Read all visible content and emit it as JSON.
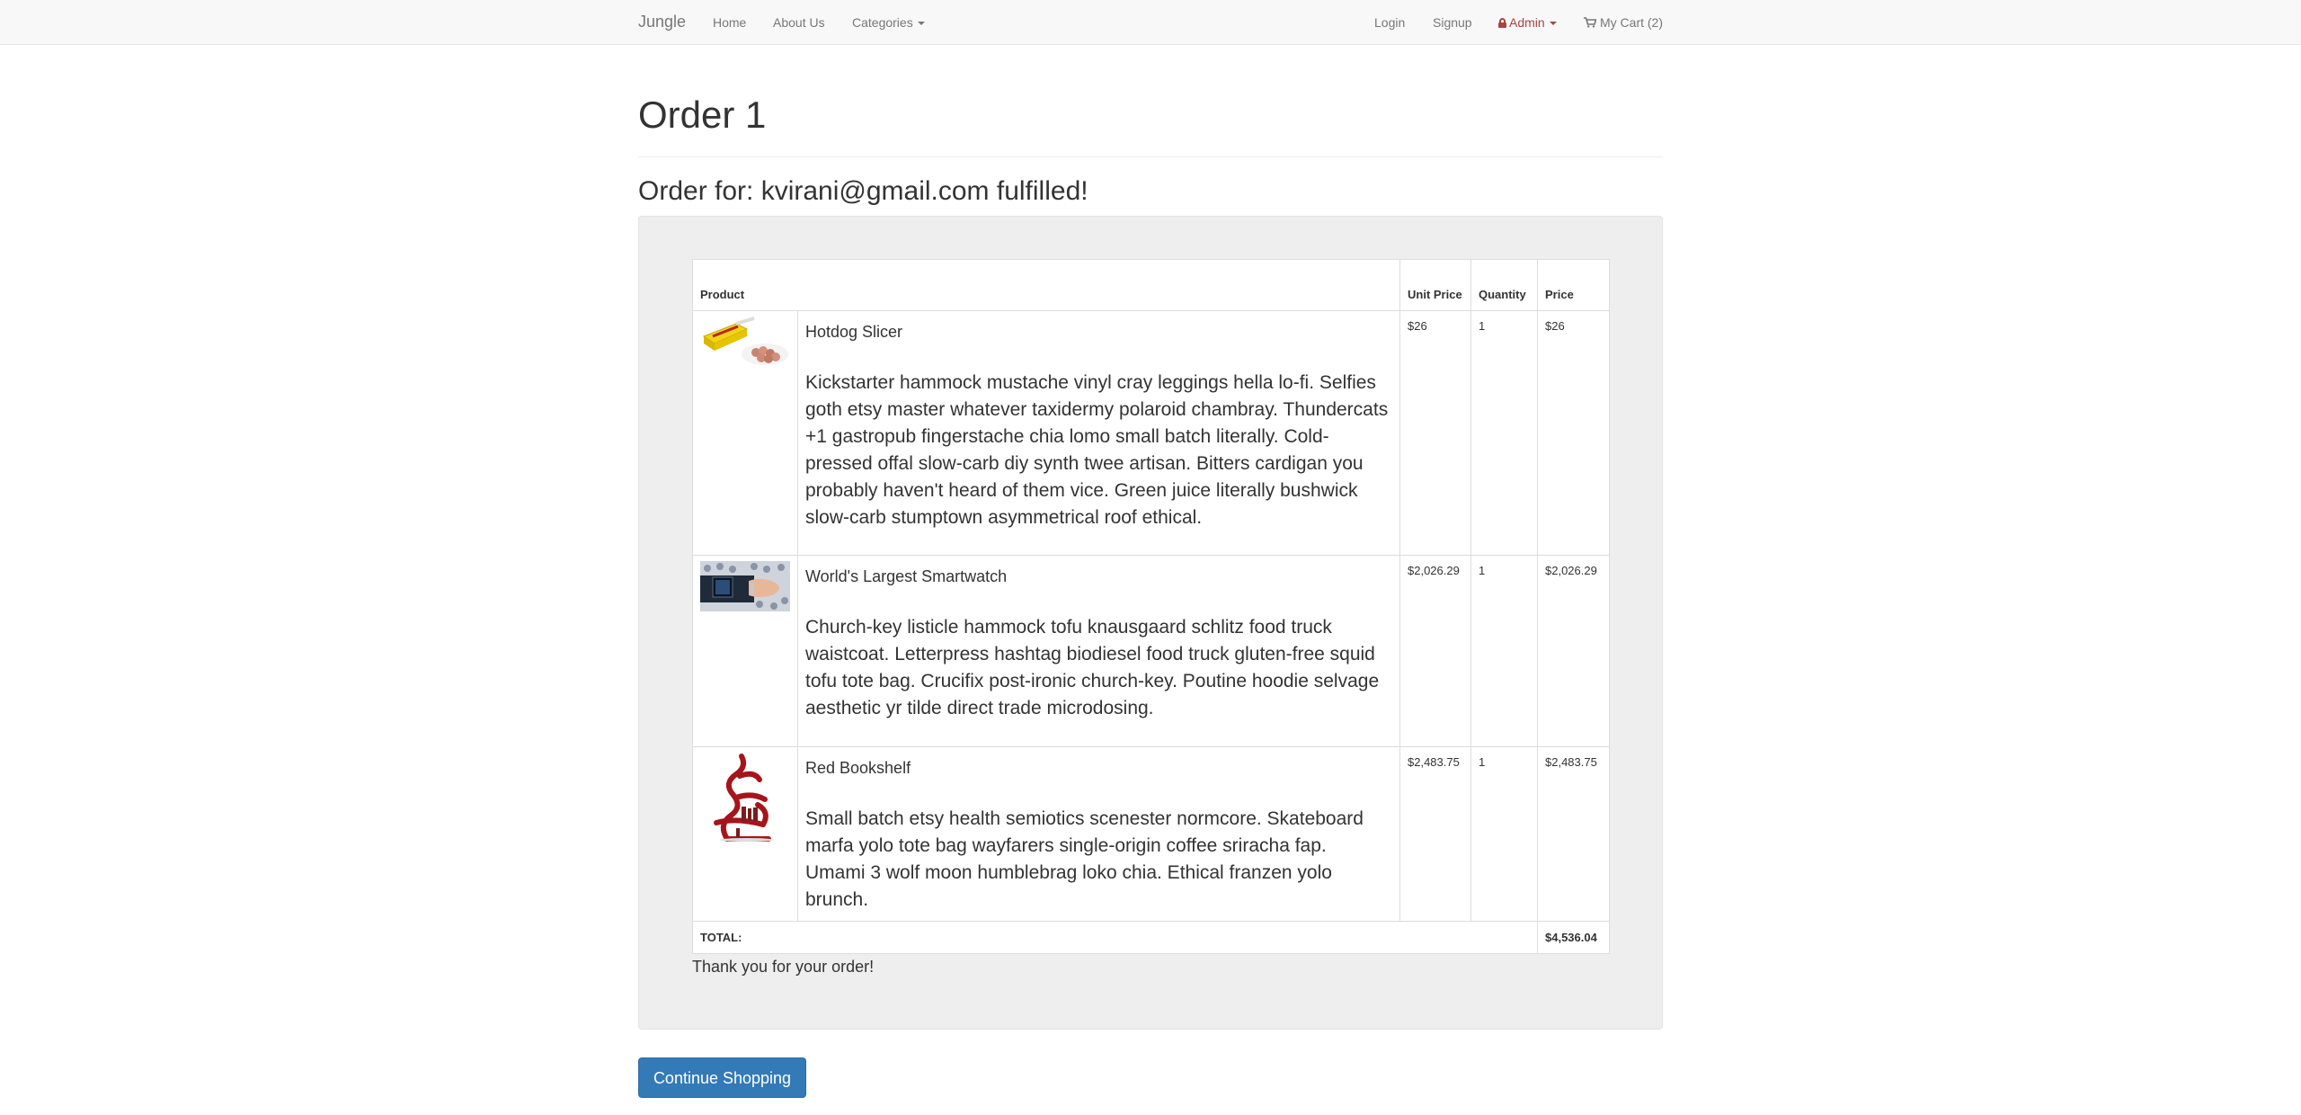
{
  "navbar": {
    "brand": "Jungle",
    "links": {
      "home": "Home",
      "about": "About Us",
      "categories": "Categories"
    },
    "right": {
      "login": "Login",
      "signup": "Signup",
      "admin": "Admin",
      "cart": "My Cart (2)"
    }
  },
  "page": {
    "title": "Order 1",
    "subtitle": "Order for: kvirani@gmail.com fulfilled!"
  },
  "table": {
    "headers": {
      "product": "Product",
      "unit_price": "Unit Price",
      "quantity": "Quantity",
      "price": "Price"
    },
    "rows": [
      {
        "name": "Hotdog Slicer",
        "description": "Kickstarter hammock mustache vinyl cray leggings hella lo-fi. Selfies goth etsy master whatever taxidermy polaroid chambray. Thundercats +1 gastropub fingerstache chia lomo small batch literally. Cold-pressed offal slow-carb diy synth twee artisan. Bitters cardigan you probably haven't heard of them vice. Green juice literally bushwick slow-carb stumptown asymmetrical roof ethical.",
        "unit_price": "$26",
        "quantity": "1",
        "price": "$26",
        "image": "hotdog-slicer-image"
      },
      {
        "name": "World's Largest Smartwatch",
        "description": "Church-key listicle hammock tofu knausgaard schlitz food truck waistcoat. Letterpress hashtag biodiesel food truck gluten-free squid tofu tote bag. Crucifix post-ironic church-key. Poutine hoodie selvage aesthetic yr tilde direct trade microdosing.",
        "unit_price": "$2,026.29",
        "quantity": "1",
        "price": "$2,026.29",
        "image": "smartwatch-image"
      },
      {
        "name": "Red Bookshelf",
        "description": "Small batch etsy health semiotics scenester normcore. Skateboard marfa yolo tote bag wayfarers single-origin coffee sriracha fap. Umami 3 wolf moon humblebrag loko chia. Ethical franzen yolo brunch.",
        "unit_price": "$2,483.75",
        "quantity": "1",
        "price": "$2,483.75",
        "image": "red-bookshelf-image"
      }
    ],
    "total_label": "TOTAL:",
    "total_value": "$4,536.04"
  },
  "thanks": "Thank you for your order!",
  "continue_button": "Continue Shopping",
  "colors": {
    "primary": "#337ab7",
    "admin": "#a94442",
    "navbar_bg": "#f8f8f8",
    "well_bg": "#eeeeee"
  }
}
